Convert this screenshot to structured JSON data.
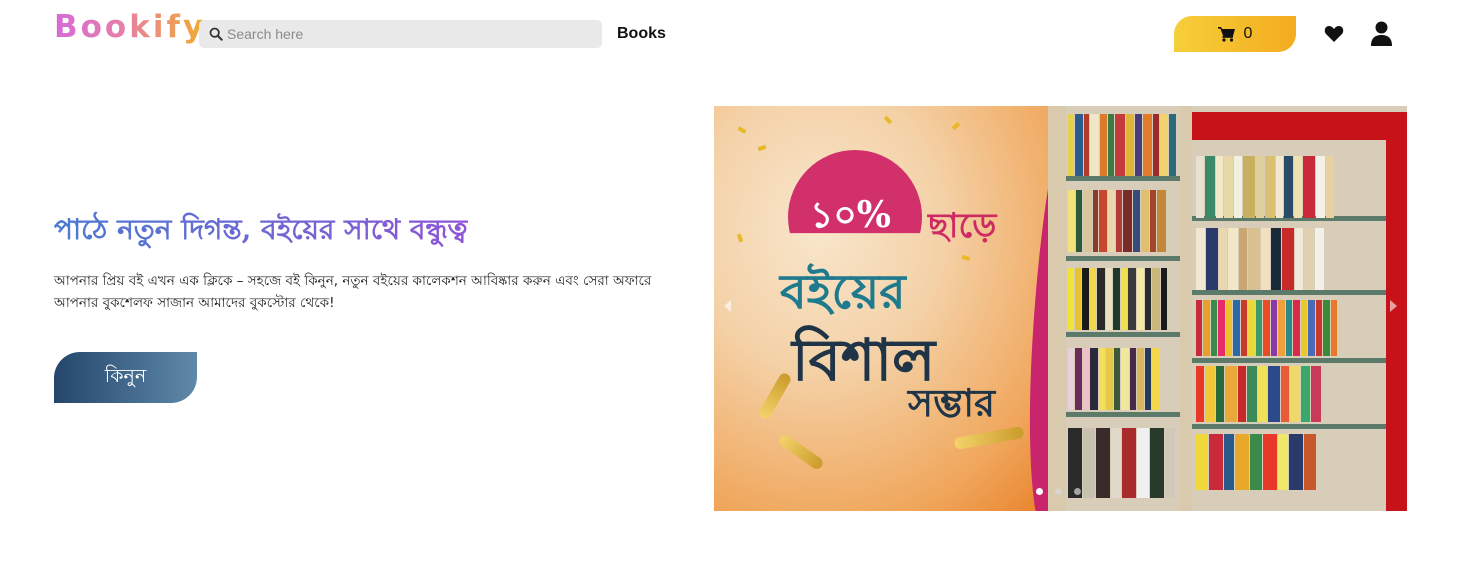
{
  "brand": {
    "name": "Bookify"
  },
  "header": {
    "search": {
      "placeholder": "Search here",
      "value": "",
      "icon": "search-icon"
    },
    "nav": {
      "books_label": "Books"
    },
    "cart": {
      "count": "0",
      "icon": "shopping-cart-icon"
    },
    "wishlist_icon": "heart-icon",
    "account_icon": "user-icon"
  },
  "hero": {
    "title": "পাঠে নতুন দিগন্ত, বইয়ের সাথে বন্ধুত্ব",
    "description": "আপনার প্রিয় বই এখন এক ক্লিকে – সহজে বই কিনুন, নতুন বইয়ের কালেকশন আবিষ্কার করুন এবং সেরা অফারে আপনার বুকশেলফ সাজান আমাদের বুকস্টোর থেকে!",
    "buy_label": "কিনুন"
  },
  "carousel": {
    "slide_count": 3,
    "active_index": 0,
    "banner": {
      "discount": "১০%",
      "discount_word": "ছাড়ে",
      "line1": "বইয়ের",
      "line2": "বিশাল",
      "line3": "সম্ভার"
    }
  },
  "colors": {
    "logo_gradient_start": "#d66bd9",
    "logo_gradient_end": "#f2ac2e",
    "cart_gradient_start": "#f6cf3a",
    "cart_gradient_end": "#f3ac1f",
    "hero_title_start": "#4b7bd1",
    "hero_title_end": "#8e55d6",
    "buy_gradient_start": "#24466c",
    "buy_gradient_end": "#5f89a9"
  }
}
